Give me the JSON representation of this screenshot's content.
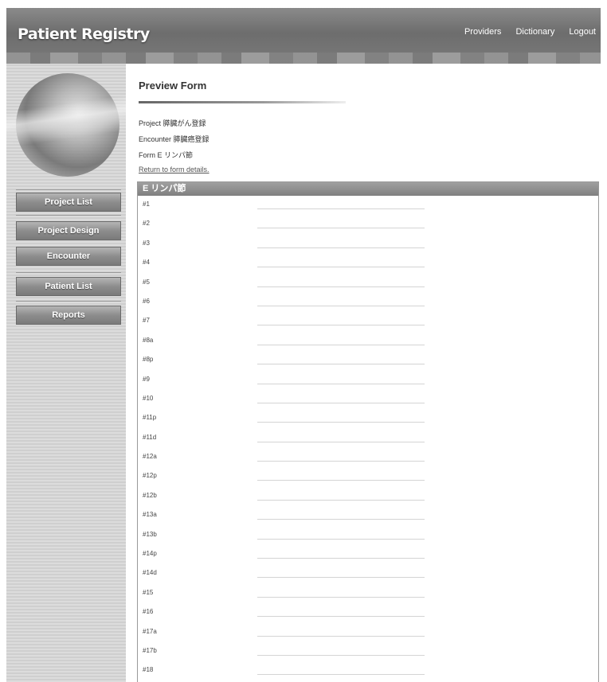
{
  "header": {
    "title": "Patient Registry",
    "links": [
      "Providers",
      "Dictionary",
      "Logout"
    ]
  },
  "sidebar": {
    "items": [
      "Project List",
      "Project Design",
      "Encounter",
      "Patient List",
      "Reports"
    ]
  },
  "main": {
    "title": "Preview Form",
    "project": "Project 膵臓がん登録",
    "encounter": "Encounter 膵臓癌登録",
    "form": "Form E リンパ節",
    "return_link": "Return to form details.",
    "panel_title": "E リンパ節",
    "rows": [
      "#1",
      "#2",
      "#3",
      "#4",
      "#5",
      "#6",
      "#7",
      "#8a",
      "#8p",
      "#9",
      "#10",
      "#11p",
      "#11d",
      "#12a",
      "#12p",
      "#12b",
      "#13a",
      "#13b",
      "#14p",
      "#14d",
      "#15",
      "#16",
      "#17a",
      "#17b",
      "#18"
    ]
  }
}
